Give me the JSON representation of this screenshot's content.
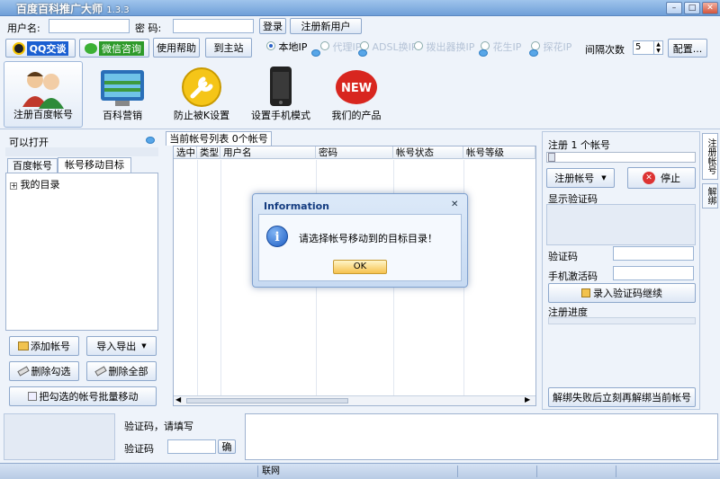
{
  "window": {
    "title": "百度百科推广大师",
    "version": "1.3.3"
  },
  "login": {
    "username_label": "用户名:",
    "password_label": "密  码:",
    "login_button": "登录",
    "register_button": "注册新用户"
  },
  "toolbar": {
    "qq_button": "QQ交谈",
    "wechat_button": "微信咨询",
    "help_button": "使用帮助",
    "home_button": "到主站",
    "ip_options": [
      "本地IP",
      "代理IP",
      "ADSL换IP",
      "拨出器换IP",
      "花生IP",
      "探花IP"
    ],
    "interval_label": "间隔次数",
    "interval_value": "5",
    "config_button": "配置..."
  },
  "bigtools": [
    {
      "label": "注册百度帐号",
      "icon": "users-icon"
    },
    {
      "label": "百科营销",
      "icon": "monitor-icon"
    },
    {
      "label": "防止被K设置",
      "icon": "wrench-icon"
    },
    {
      "label": "设置手机模式",
      "icon": "phone-icon"
    },
    {
      "label": "我们的产品",
      "icon": "new-badge-icon"
    }
  ],
  "left": {
    "open_label": "可以打开",
    "tabs": [
      "百度帐号",
      "帐号移动目标"
    ],
    "tree_root": "我的目录",
    "add_button": "添加帐号",
    "import_button": "导入导出",
    "delete_checked": "删除勾选",
    "delete_all": "删除全部",
    "batch_move": "把勾选的帐号批量移动"
  },
  "center": {
    "tab": "当前帐号列表 0个帐号",
    "columns": [
      "选中",
      "类型",
      "用户名",
      "密码",
      "帐号状态",
      "帐号等级"
    ]
  },
  "right": {
    "register_count": "注册 1 个帐号",
    "register_button": "注册帐号",
    "stop_button": "停止",
    "captcha_display": "显示验证码",
    "captcha_label": "验证码",
    "sms_label": "手机激活码",
    "enter_captcha_button": "录入验证码继续",
    "progress_label": "注册进度",
    "unbind_button": "解绑失败后立刻再解绑当前帐号",
    "side_tabs": [
      "注册帐号",
      "解绑"
    ]
  },
  "bottom": {
    "captcha_prompt": "验证码，请填写",
    "captcha_label": "验证码",
    "confirm_button": "确"
  },
  "status": {
    "network": "联网"
  },
  "dialog": {
    "title": "Information",
    "message": "请选择帐号移动到的目标目录！",
    "ok": "OK"
  }
}
